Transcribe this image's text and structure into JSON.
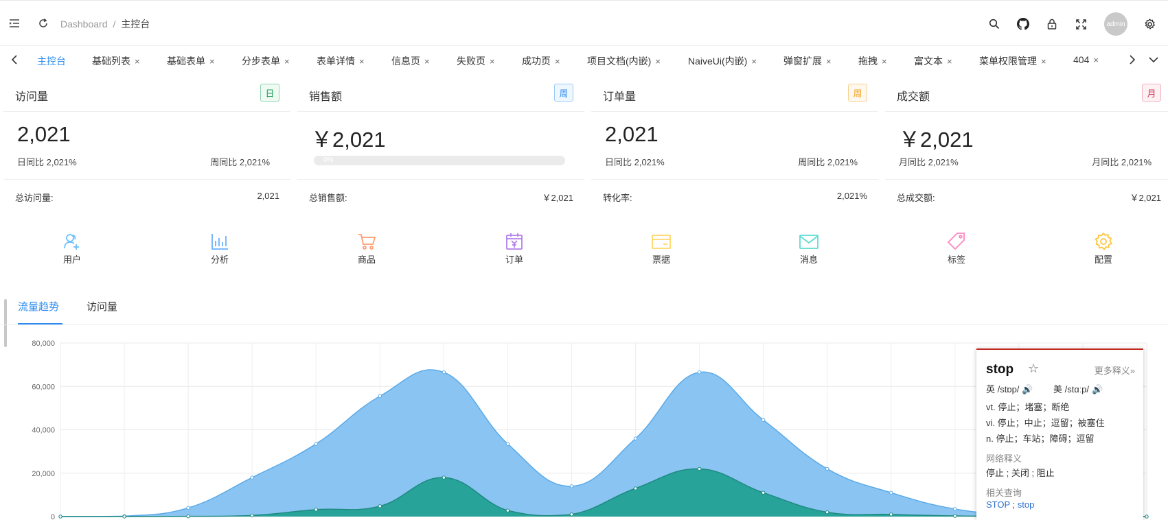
{
  "header": {
    "breadcrumb": {
      "root": "Dashboard",
      "sep": "/",
      "current": "主控台"
    },
    "avatar": "admin",
    "icons": [
      "menu-fold-icon",
      "refresh-icon",
      "search-icon",
      "github-icon",
      "lock-icon",
      "fullscreen-icon",
      "gear-icon"
    ]
  },
  "tabs": [
    "主控台",
    "基础列表",
    "基础表单",
    "分步表单",
    "表单详情",
    "信息页",
    "失败页",
    "成功页",
    "项目文档(内嵌)",
    "NaiveUi(内嵌)",
    "弹窗扩展",
    "拖拽",
    "富文本",
    "菜单权限管理",
    "404"
  ],
  "tab_close": "×",
  "cards": [
    {
      "title": "访问量",
      "tag": "日",
      "big": "2,021",
      "left": "日同比 2,021%",
      "right": "周同比 2,021%",
      "foot_label": "总访问量:",
      "foot_value": "2,021"
    },
    {
      "title": "销售额",
      "tag": "周",
      "big": "￥2,021",
      "progress": "0%",
      "foot_label": "总销售额:",
      "foot_value": "￥2,021"
    },
    {
      "title": "订单量",
      "tag": "周",
      "big": "2,021",
      "left": "日同比 2,021%",
      "right": "周同比 2,021%",
      "foot_label": "转化率:",
      "foot_value": "2,021%"
    },
    {
      "title": "成交额",
      "tag": "月",
      "big": "￥2,021",
      "left": "月同比 2,021%",
      "right": "月同比 2,021%",
      "foot_label": "总成交额:",
      "foot_value": "￥2,021"
    }
  ],
  "tag_colors": [
    "#18a058",
    "#2d8cf0",
    "#f0a020",
    "#e8808a"
  ],
  "quick": [
    {
      "label": "用户",
      "color": "#69c0ff"
    },
    {
      "label": "分析",
      "color": "#69b1ff"
    },
    {
      "label": "商品",
      "color": "#ff9c6e"
    },
    {
      "label": "订单",
      "color": "#b37feb"
    },
    {
      "label": "票据",
      "color": "#ffd666"
    },
    {
      "label": "消息",
      "color": "#5cdbd3"
    },
    {
      "label": "标签",
      "color": "#ff85c0"
    },
    {
      "label": "配置",
      "color": "#ffc53d"
    }
  ],
  "chart_tabs": [
    "流量趋势",
    "访问量"
  ],
  "chart_data": {
    "type": "area",
    "x": [
      "1",
      "2",
      "3",
      "4",
      "5",
      "6",
      "7",
      "8",
      "9",
      "10",
      "11",
      "12",
      "13",
      "14",
      "15",
      "16",
      "17",
      "18"
    ],
    "ylim": [
      0,
      80000
    ],
    "yticks": [
      "80,000",
      "60,000",
      "40,000",
      "20,000",
      "0"
    ],
    "series": [
      {
        "color": "#8ac4f2",
        "stroke": "#5aaae8",
        "values": [
          0,
          200,
          4000,
          18000,
          33500,
          55500,
          66500,
          33500,
          14000,
          36000,
          66500,
          44500,
          22000,
          11000,
          3500,
          800,
          200,
          0
        ]
      },
      {
        "color": "#27a39a",
        "stroke": "#1e8a80",
        "values": [
          0,
          0,
          100,
          500,
          3200,
          4800,
          18000,
          2800,
          1000,
          13000,
          22000,
          11000,
          2000,
          1000,
          300,
          100,
          0,
          0
        ]
      }
    ]
  },
  "dict": {
    "word": "stop",
    "star": "☆",
    "more": "更多释义»",
    "uk": "英 /stɒp/",
    "us": "美 /stɑːp/",
    "speaker": "🔊",
    "defs": [
      "vt. 停止；堵塞；断绝",
      "vi. 停止；中止；逗留；被塞住",
      "n. 停止；车站；障碍；逗留"
    ],
    "web_title": "网络释义",
    "web": "停止 ; 关闭 ; 阻止",
    "related_title": "相关查询",
    "related1": "STOP",
    "related_sep": " ; ",
    "related2": "stop"
  }
}
